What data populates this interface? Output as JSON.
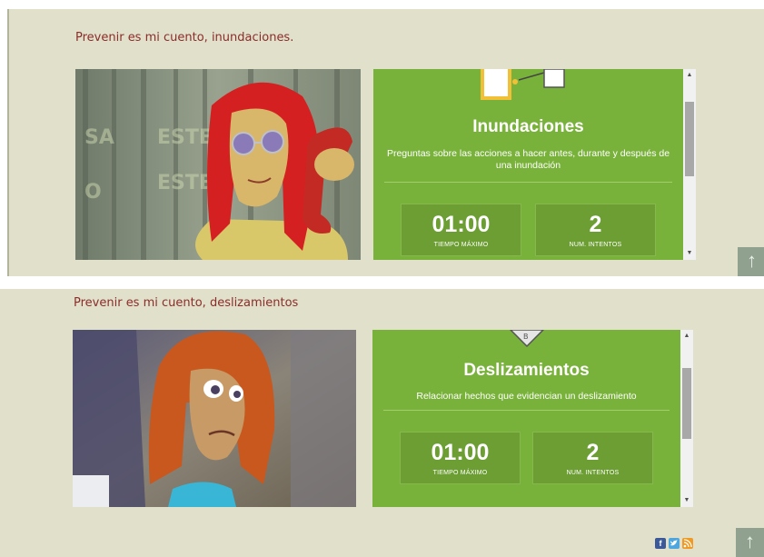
{
  "sections": [
    {
      "title": "Prevenir es mi cuento, inundaciones.",
      "quiz": {
        "heading": "Inundaciones",
        "description": "Preguntas sobre las acciones a hacer antes, durante y después de una inundación",
        "time_value": "01:00",
        "time_label": "TIEMPO MÁXIMO",
        "attempts_value": "2",
        "attempts_label": "NUM. INTENTOS"
      }
    },
    {
      "title": "Prevenir es mi cuento, deslizamientos",
      "quiz": {
        "heading": "Deslizamientos",
        "description": "Relacionar hechos que evidencian un deslizamiento",
        "time_value": "01:00",
        "time_label": "TIEMPO MÁXIMO",
        "attempts_value": "2",
        "attempts_label": "NUM. INTENTOS"
      }
    }
  ],
  "scroll_to_top_icon": "arrow-up-icon",
  "social": {
    "facebook": "f",
    "twitter": "t",
    "rss": "rss"
  },
  "colors": {
    "panel_bg": "#e1e0ca",
    "title_text": "#8b2d2a",
    "quiz_bg": "#79b23a",
    "stat_bg": "#6c9e33"
  }
}
